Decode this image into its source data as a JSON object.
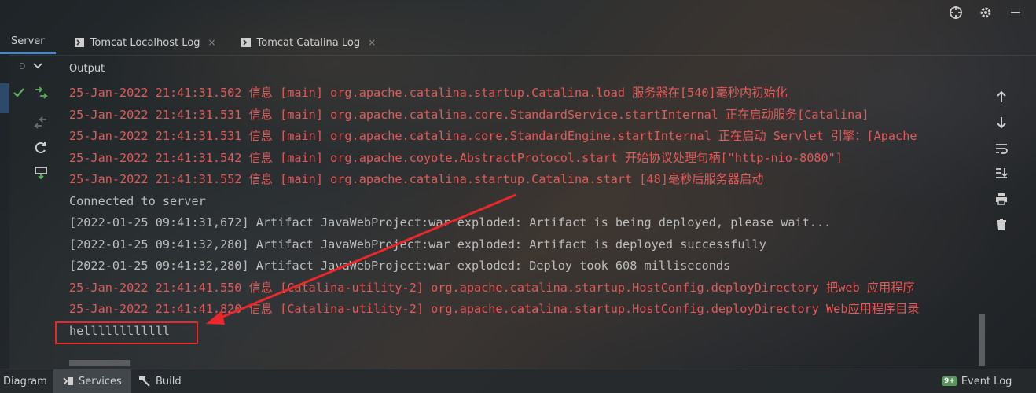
{
  "tabs": [
    {
      "label": "Server",
      "closable": false
    },
    {
      "label": "Tomcat Localhost Log",
      "closable": true
    },
    {
      "label": "Tomcat Catalina Log",
      "closable": true
    }
  ],
  "close_glyph": "×",
  "dropdown_label": "D",
  "output_label": "Output",
  "console_lines": [
    {
      "text": "25-Jan-2022 21:41:31.502 信息 [main] org.apache.catalina.startup.Catalina.load 服务器在[540]毫秒内初始化",
      "color": "red"
    },
    {
      "text": "25-Jan-2022 21:41:31.531 信息 [main] org.apache.catalina.core.StandardService.startInternal 正在启动服务[Catalina]",
      "color": "red"
    },
    {
      "text": "25-Jan-2022 21:41:31.531 信息 [main] org.apache.catalina.core.StandardEngine.startInternal 正在启动 Servlet 引擎：[Apache",
      "color": "red"
    },
    {
      "text": "25-Jan-2022 21:41:31.542 信息 [main] org.apache.coyote.AbstractProtocol.start 开始协议处理句柄[\"http-nio-8080\"]",
      "color": "red"
    },
    {
      "text": "25-Jan-2022 21:41:31.552 信息 [main] org.apache.catalina.startup.Catalina.start [48]毫秒后服务器启动",
      "color": "red"
    },
    {
      "text": "Connected to server",
      "color": "grey"
    },
    {
      "text": "[2022-01-25 09:41:31,672] Artifact JavaWebProject:war exploded: Artifact is being deployed, please wait...",
      "color": "grey"
    },
    {
      "text": "[2022-01-25 09:41:32,280] Artifact JavaWebProject:war exploded: Artifact is deployed successfully",
      "color": "grey"
    },
    {
      "text": "[2022-01-25 09:41:32,280] Artifact JavaWebProject:war exploded: Deploy took 608 milliseconds",
      "color": "grey"
    },
    {
      "text": "25-Jan-2022 21:41:41.550 信息 [Catalina-utility-2] org.apache.catalina.startup.HostConfig.deployDirectory 把web 应用程序",
      "color": "red"
    },
    {
      "text": "25-Jan-2022 21:41:41.820 信息 [Catalina-utility-2] org.apache.catalina.startup.HostConfig.deployDirectory Web应用程序目录",
      "color": "red"
    },
    {
      "text": "hellllllllllll",
      "color": "grey"
    }
  ],
  "bottom_bar": {
    "diagram": "Diagram",
    "services": "Services",
    "build": "Build",
    "event_badge": "9+",
    "event_log": "Event Log"
  },
  "colors": {
    "accent": "#4a88c7",
    "log_red": "#e15a5a",
    "annotation_red": "#e8282a",
    "success_green": "#5fb05f"
  },
  "icons": {
    "top": [
      "crosshair-icon",
      "gear-icon",
      "minimize-icon"
    ],
    "gutter": [
      "check-icon",
      "deploy-icon",
      "undeploy-icon",
      "refresh-icon",
      "redeploy-icon"
    ],
    "right": [
      "arrow-up-icon",
      "arrow-down-icon",
      "soft-wrap-icon",
      "scroll-to-end-icon",
      "print-icon",
      "trash-icon"
    ]
  }
}
